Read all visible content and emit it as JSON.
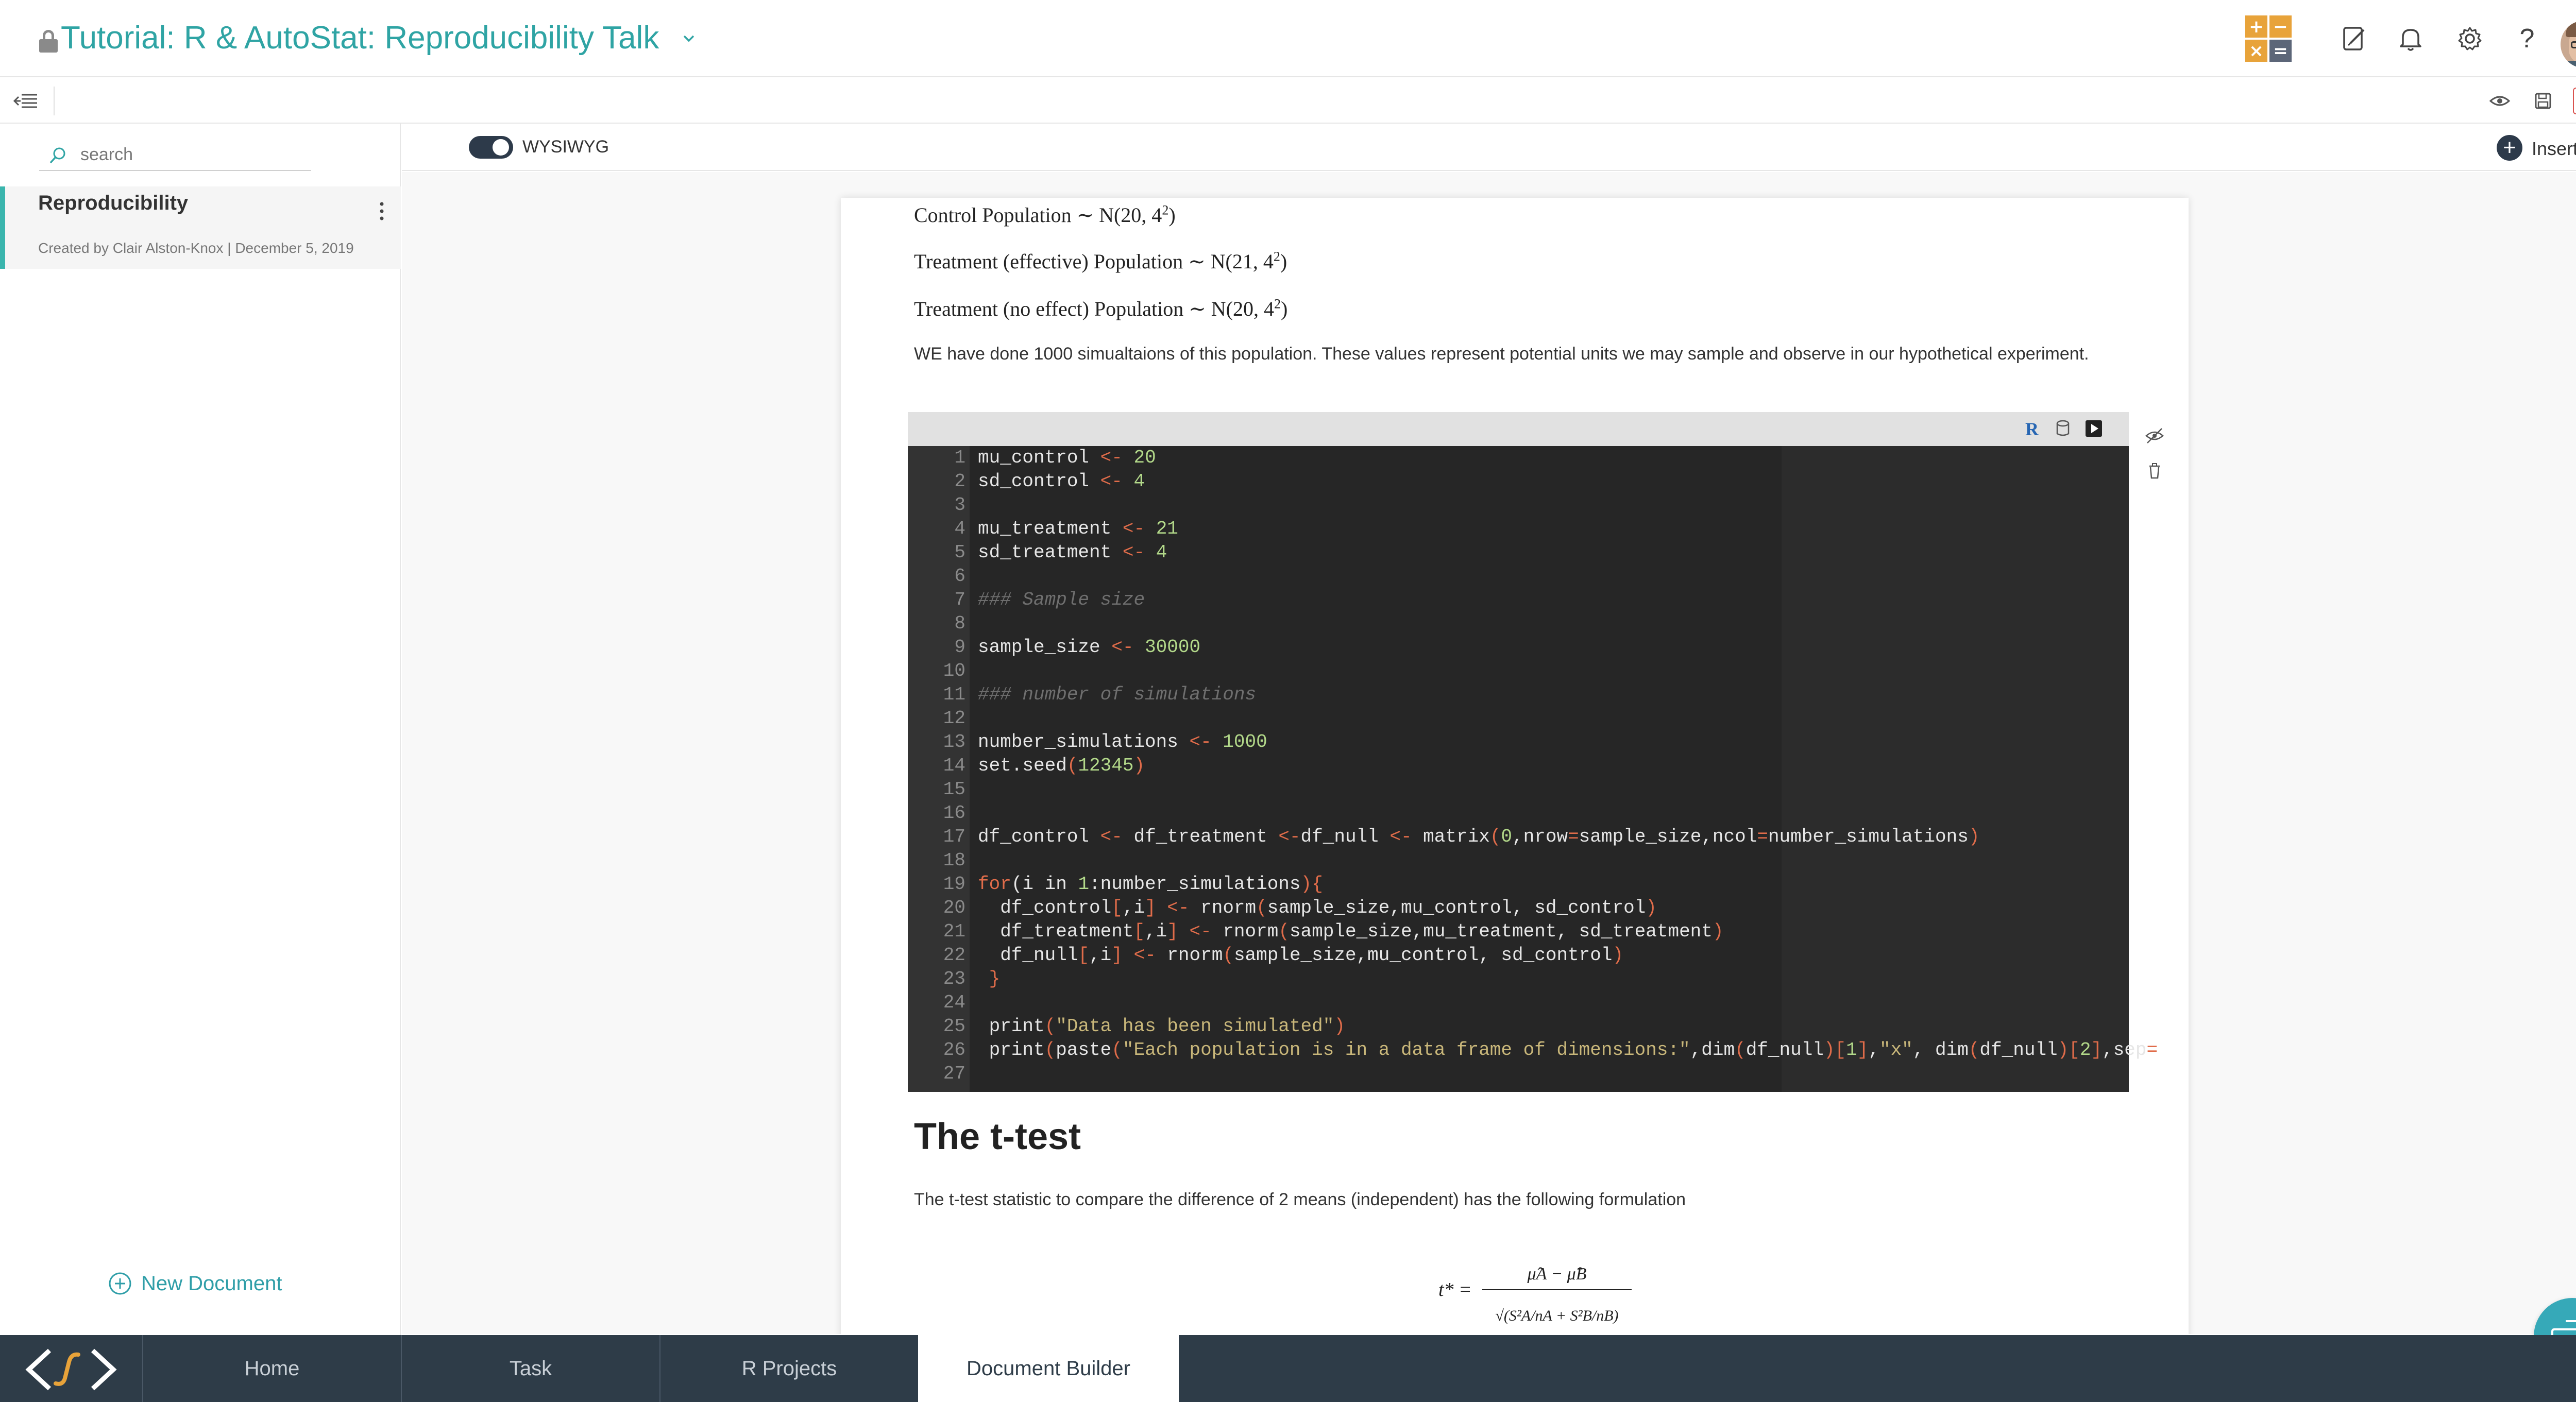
{
  "header": {
    "title": "Tutorial: R & AutoStat: Reproducibility Talk",
    "calc_icon": {
      "plus": "+",
      "minus": "−",
      "times": "×",
      "equals": "="
    },
    "icons": [
      "edit-note-icon",
      "bell-icon",
      "gear-icon",
      "help-icon"
    ],
    "help_glyph": "?"
  },
  "toolbar": {
    "right_icons": [
      "eye-icon",
      "save-icon",
      "trash-icon"
    ],
    "trash_color": "#d9534f"
  },
  "sidebar": {
    "search_placeholder": "search",
    "document": {
      "title": "Reproducibility",
      "meta": "Created by Clair Alston-Knox | December 5, 2019"
    },
    "new_document_label": "New Document"
  },
  "editor": {
    "mode_label": "WYSIWYG",
    "insert_label": "Insert",
    "insert_plus": "+",
    "math": {
      "control": {
        "label": "Control Population",
        "sim": " ∼ ",
        "dist": "N(20, 4",
        "power": "2",
        "close": ")"
      },
      "treat_eff": {
        "label": "Treatment (effective) Population",
        "sim": " ∼ ",
        "dist": "N(21, 4",
        "power": "2",
        "close": ")"
      },
      "treat_none": {
        "label": " Treatment (no effect) Population",
        "sim": " ∼ ",
        "dist": "N(20, 4",
        "power": "2",
        "close": ")"
      }
    },
    "para1": "WE have done 1000 simualtaions of this population. These values represent potential units we may sample and observe in our hypothetical experiment.",
    "code": {
      "r_badge": "R",
      "lines": [
        {
          "n": "1",
          "parts": [
            [
              "mu_control ",
              ""
            ],
            [
              "<-",
              "op"
            ],
            [
              " ",
              ""
            ],
            [
              "20",
              "num"
            ]
          ]
        },
        {
          "n": "2",
          "parts": [
            [
              "sd_control ",
              ""
            ],
            [
              "<-",
              "op"
            ],
            [
              " ",
              ""
            ],
            [
              "4",
              "num"
            ]
          ]
        },
        {
          "n": "3",
          "parts": []
        },
        {
          "n": "4",
          "parts": [
            [
              "mu_treatment ",
              ""
            ],
            [
              "<-",
              "op"
            ],
            [
              " ",
              ""
            ],
            [
              "21",
              "num"
            ]
          ]
        },
        {
          "n": "5",
          "parts": [
            [
              "sd_treatment ",
              ""
            ],
            [
              "<-",
              "op"
            ],
            [
              " ",
              ""
            ],
            [
              "4",
              "num"
            ]
          ]
        },
        {
          "n": "6",
          "parts": []
        },
        {
          "n": "7",
          "parts": [
            [
              "### Sample size",
              "cmt"
            ]
          ]
        },
        {
          "n": "8",
          "parts": []
        },
        {
          "n": "9",
          "parts": [
            [
              "sample_size ",
              ""
            ],
            [
              "<-",
              "op"
            ],
            [
              " ",
              ""
            ],
            [
              "30000",
              "num"
            ]
          ]
        },
        {
          "n": "10",
          "parts": []
        },
        {
          "n": "11",
          "parts": [
            [
              "### number of simulations",
              "cmt"
            ]
          ]
        },
        {
          "n": "12",
          "parts": []
        },
        {
          "n": "13",
          "parts": [
            [
              "number_simulations ",
              ""
            ],
            [
              "<-",
              "op"
            ],
            [
              " ",
              ""
            ],
            [
              "1000",
              "num"
            ]
          ]
        },
        {
          "n": "14",
          "parts": [
            [
              "set.seed",
              ""
            ],
            [
              "(",
              "op"
            ],
            [
              "12345",
              "num"
            ],
            [
              ")",
              "op"
            ]
          ]
        },
        {
          "n": "15",
          "parts": []
        },
        {
          "n": "16",
          "parts": []
        },
        {
          "n": "17",
          "parts": [
            [
              "df_control ",
              ""
            ],
            [
              "<-",
              "op"
            ],
            [
              " df_treatment ",
              ""
            ],
            [
              "<-",
              "op"
            ],
            [
              "df_null ",
              ""
            ],
            [
              "<-",
              "op"
            ],
            [
              " matrix",
              ""
            ],
            [
              "(",
              "op"
            ],
            [
              "0",
              "num"
            ],
            [
              ",nrow",
              ""
            ],
            [
              "=",
              "op"
            ],
            [
              "sample_size,ncol",
              ""
            ],
            [
              "=",
              "op"
            ],
            [
              "number_simulations",
              ""
            ],
            [
              ")",
              "op"
            ]
          ]
        },
        {
          "n": "18",
          "parts": []
        },
        {
          "n": "19",
          "parts": [
            [
              "for",
              "op"
            ],
            [
              "(i in ",
              ""
            ],
            [
              "1",
              "num"
            ],
            [
              ":number_simulations",
              ""
            ],
            [
              ")",
              "op"
            ],
            [
              "{",
              "op"
            ]
          ]
        },
        {
          "n": "20",
          "parts": [
            [
              "  df_control",
              ""
            ],
            [
              "[",
              "op"
            ],
            [
              ",i",
              ""
            ],
            [
              "]",
              "op"
            ],
            [
              " ",
              ""
            ],
            [
              "<-",
              "op"
            ],
            [
              " rnorm",
              ""
            ],
            [
              "(",
              "op"
            ],
            [
              "sample_size,mu_control, sd_control",
              ""
            ],
            [
              ")",
              "op"
            ]
          ]
        },
        {
          "n": "21",
          "parts": [
            [
              "  df_treatment",
              ""
            ],
            [
              "[",
              "op"
            ],
            [
              ",i",
              ""
            ],
            [
              "]",
              "op"
            ],
            [
              " ",
              ""
            ],
            [
              "<-",
              "op"
            ],
            [
              " rnorm",
              ""
            ],
            [
              "(",
              "op"
            ],
            [
              "sample_size,mu_treatment, sd_treatment",
              ""
            ],
            [
              ")",
              "op"
            ]
          ]
        },
        {
          "n": "22",
          "parts": [
            [
              "  df_null",
              ""
            ],
            [
              "[",
              "op"
            ],
            [
              ",i",
              ""
            ],
            [
              "]",
              "op"
            ],
            [
              " ",
              ""
            ],
            [
              "<-",
              "op"
            ],
            [
              " rnorm",
              ""
            ],
            [
              "(",
              "op"
            ],
            [
              "sample_size,mu_control, sd_control",
              ""
            ],
            [
              ")",
              "op"
            ]
          ]
        },
        {
          "n": "23",
          "parts": [
            [
              " }",
              "op"
            ]
          ]
        },
        {
          "n": "24",
          "parts": []
        },
        {
          "n": "25",
          "parts": [
            [
              " print",
              ""
            ],
            [
              "(",
              "op"
            ],
            [
              "\"Data has been simulated\"",
              "str"
            ],
            [
              ")",
              "op"
            ]
          ]
        },
        {
          "n": "26",
          "parts": [
            [
              " print",
              ""
            ],
            [
              "(",
              "op"
            ],
            [
              "paste",
              ""
            ],
            [
              "(",
              "op"
            ],
            [
              "\"Each population is in a data frame of dimensions:\"",
              "str"
            ],
            [
              ",dim",
              ""
            ],
            [
              "(",
              "op"
            ],
            [
              "df_null",
              ""
            ],
            [
              ")",
              "op"
            ],
            [
              "[",
              "op"
            ],
            [
              "1",
              "num"
            ],
            [
              "]",
              "op"
            ],
            [
              ",",
              ""
            ],
            [
              "\"x\"",
              "str"
            ],
            [
              ", dim",
              ""
            ],
            [
              "(",
              "op"
            ],
            [
              "df_null",
              ""
            ],
            [
              ")",
              "op"
            ],
            [
              "[",
              "op"
            ],
            [
              "2",
              "num"
            ],
            [
              "]",
              "op"
            ],
            [
              ",sep",
              ""
            ],
            [
              "=",
              "op"
            ]
          ]
        },
        {
          "n": "27",
          "parts": []
        }
      ]
    },
    "heading": "The t-test",
    "para2": "The t-test statistic to compare the difference of 2 means (independent) has the following formulation",
    "formula": {
      "lhs": "t* =",
      "numerator": "μ̂A − μ̂B",
      "denominator": "√(S²A/nA + S²B/nB)"
    }
  },
  "bottom_nav": {
    "tabs": [
      {
        "label": "Home",
        "active": false
      },
      {
        "label": "Task",
        "active": false
      },
      {
        "label": "R Projects",
        "active": false
      },
      {
        "label": "Document Builder",
        "active": true
      }
    ]
  },
  "colors": {
    "accent": "#2fa4a4",
    "nav_bg": "#2e3c48",
    "code_bg": "#262626",
    "chat_bg": "#36a9b8"
  }
}
